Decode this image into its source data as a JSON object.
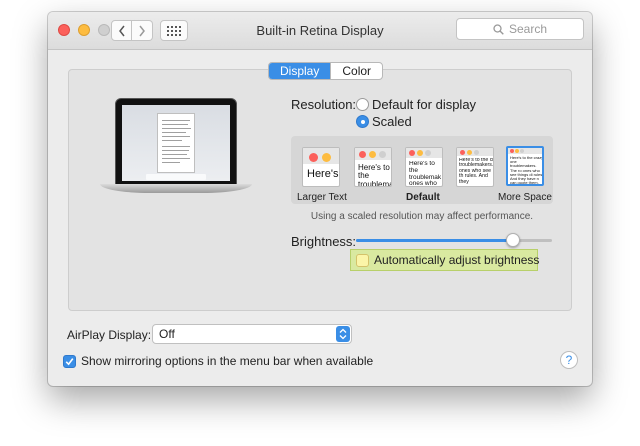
{
  "window": {
    "title": "Built-in Retina Display"
  },
  "search": {
    "placeholder": "Search"
  },
  "tabs": [
    {
      "label": "Display",
      "active": true
    },
    {
      "label": "Color",
      "active": false
    }
  ],
  "resolution": {
    "label": "Resolution:",
    "options": [
      {
        "label": "Default for display",
        "selected": false
      },
      {
        "label": "Scaled",
        "selected": true
      }
    ]
  },
  "scaled_options": {
    "thumbs": [
      {
        "text": "Here's"
      },
      {
        "text": "Here's to the troublemak"
      },
      {
        "text": "Here's to the troublemak ones who"
      },
      {
        "text": "Here's to the cr troublemakers. ones who see th rules. And they"
      },
      {
        "text": "Here's to the crazy one troublemakers. The ro ones who see things di rules. And they have n can quote them, disagre them. About the only th Because they change th"
      }
    ],
    "selected_index": 4,
    "labels": {
      "left": "Larger Text",
      "middle": "Default",
      "right": "More Space"
    },
    "note": "Using a scaled resolution may affect performance."
  },
  "brightness": {
    "label": "Brightness:",
    "level": 0.8,
    "auto_label": "Automatically adjust brightness",
    "auto_checked": false
  },
  "airplay": {
    "label": "AirPlay Display:",
    "value": "Off"
  },
  "mirroring": {
    "label": "Show mirroring options in the menu bar when available",
    "checked": true
  },
  "help": {
    "symbol": "?"
  },
  "colors": {
    "accent": "#3a8ee6",
    "highlight": "#d9e9a0",
    "close": "#fc605b",
    "minimize": "#fdbc40"
  },
  "icons": [
    "back-chevron-icon",
    "forward-chevron-icon",
    "grid-icon",
    "search-icon",
    "checkmark-icon",
    "updown-arrows-icon",
    "help-icon"
  ]
}
